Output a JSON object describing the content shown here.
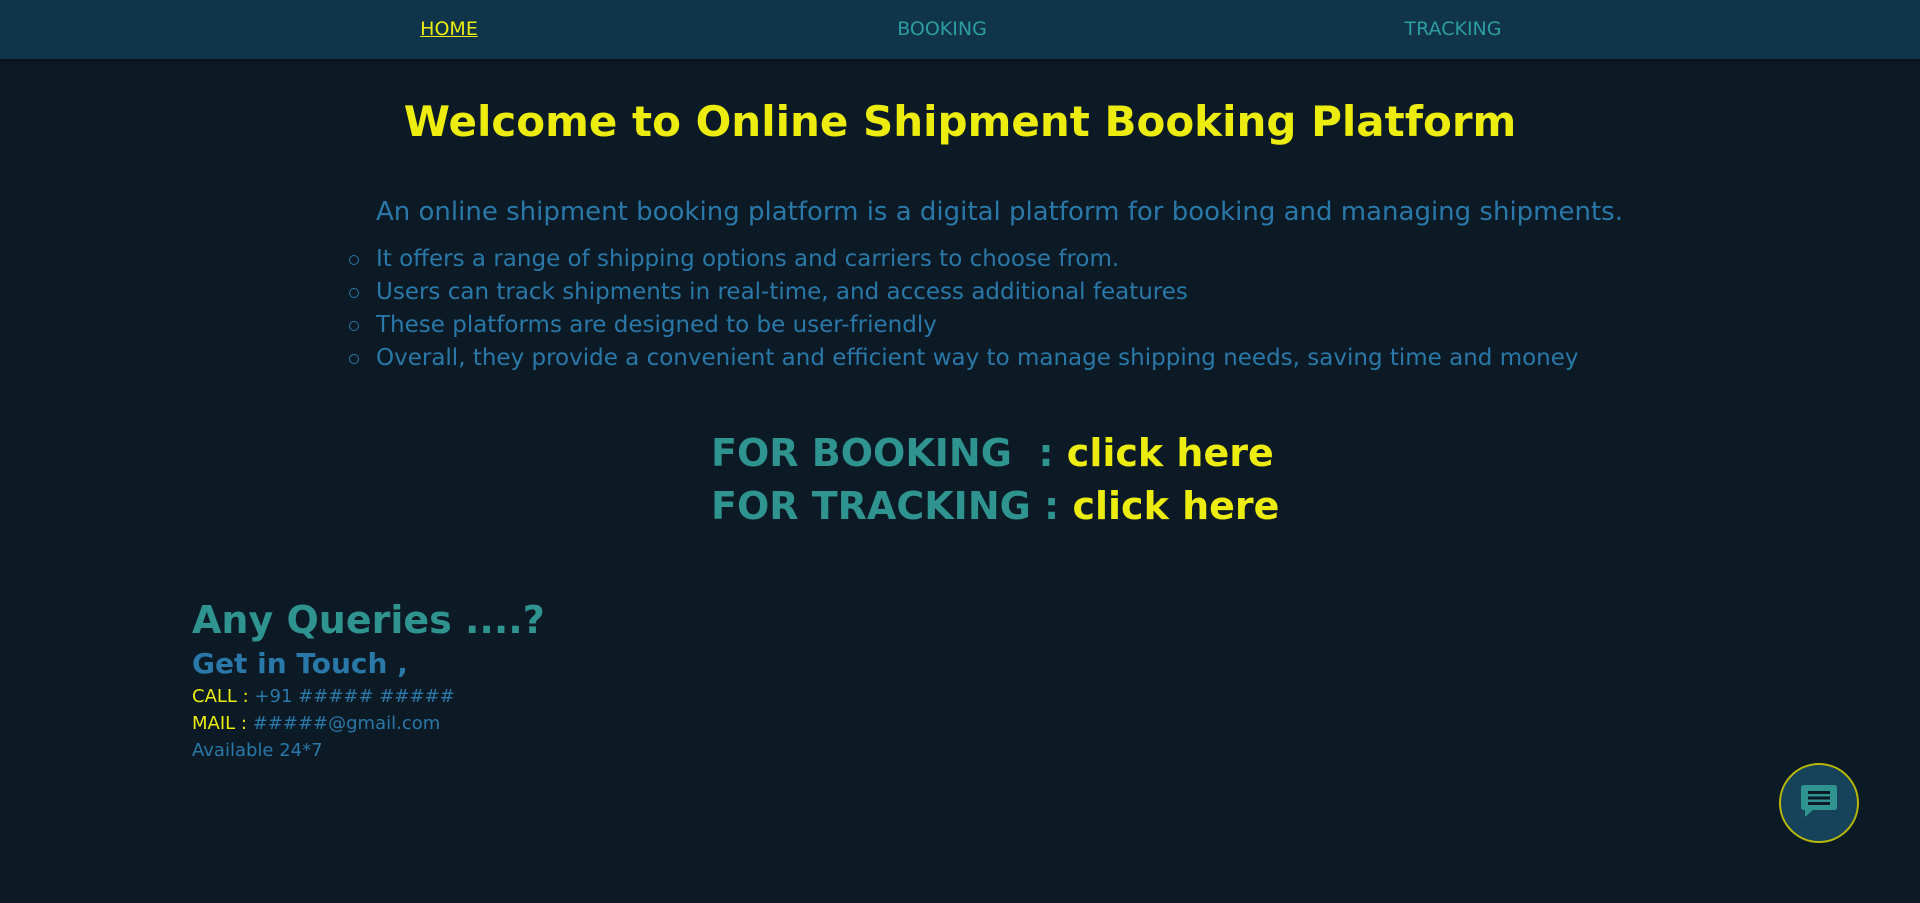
{
  "nav": {
    "home": "HOME",
    "booking": "BOOKING",
    "tracking": "TRACKING"
  },
  "main": {
    "title": "Welcome to Online Shipment Booking Platform",
    "intro": "An online shipment booking platform is a digital platform for booking and managing shipments.",
    "features": [
      "It offers a range of shipping options and carriers to choose from.",
      "Users can track shipments in real-time, and access additional features",
      "These platforms are designed to be user-friendly",
      "Overall, they provide a convenient and efficient way to manage shipping needs, saving time and money"
    ],
    "booking_label": "FOR BOOKING  : ",
    "booking_link": "click here",
    "tracking_label": "FOR TRACKING : ",
    "tracking_link": "click here"
  },
  "contact": {
    "heading": "Any Queries ....?",
    "subheading": "Get in Touch ,",
    "call_label": "CALL : ",
    "call_value": "+91 ##### #####",
    "mail_label": "MAIL : ",
    "mail_value": "#####@gmail.com",
    "availability": "Available 24*7"
  },
  "chat": {
    "icon": "chat-bubble-icon"
  },
  "colors": {
    "background": "#0c1a25",
    "navbar": "#10344a",
    "accent_yellow": "#ecec0e",
    "teal": "#2f9390",
    "blue_text": "#2978a8"
  }
}
